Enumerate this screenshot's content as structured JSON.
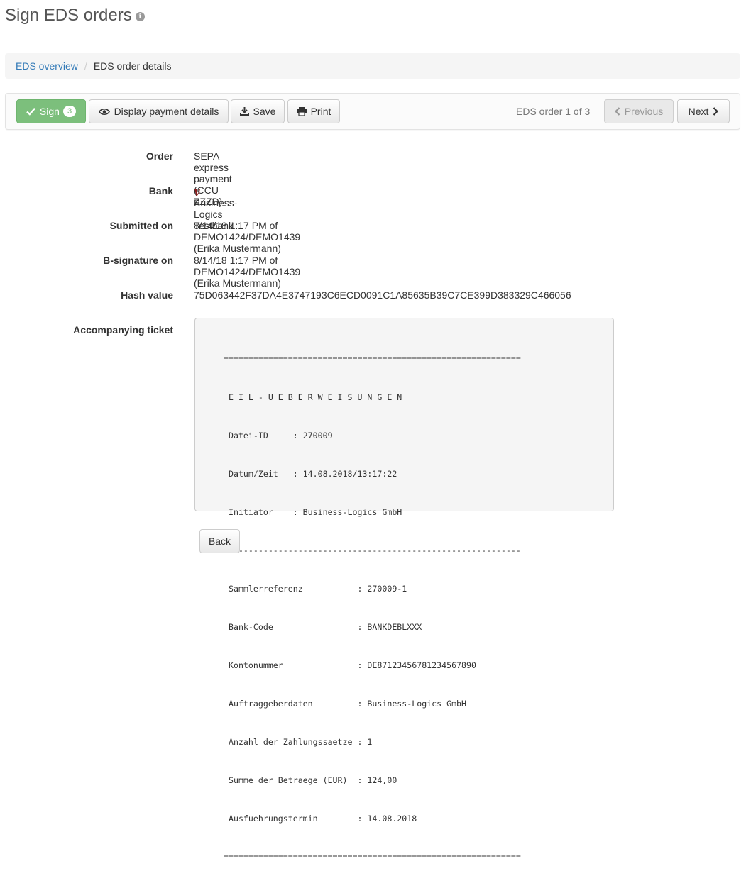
{
  "header": {
    "title": "Sign EDS orders",
    "info_icon": "info-icon"
  },
  "breadcrumb": {
    "items": [
      "EDS overview",
      "EDS order details"
    ]
  },
  "toolbar": {
    "sign_label": "Sign",
    "sign_count": "3",
    "display_label": "Display payment details",
    "save_label": "Save",
    "print_label": "Print",
    "order_counter": "EDS order 1 of 3",
    "previous_label": "Previous",
    "next_label": "Next"
  },
  "details": {
    "order_label": "Order",
    "order_value": "SEPA express payment (CCU ZZZD)",
    "bank_label": "Bank",
    "bank_value": "Business-Logics Testbank",
    "submitted_label": "Submitted on",
    "submitted_value": "8/14/18 1:17 PM of DEMO1424/DEMO1439 (Erika Mustermann)",
    "bsig_label": "B-signature on",
    "bsig_value": "8/14/18 1:17 PM of DEMO1424/DEMO1439 (Erika Mustermann)",
    "hash_label": "Hash value",
    "hash_value": "75D063442F37DA4E3747193C6ECD0091C1A85635B39C7CE399D383329C466056",
    "ticket_label": "Accompanying ticket",
    "ticket_lines": [
      "============================================================",
      " E I L - U E B E R W E I S U N G E N",
      " Datei-ID     : 270009",
      " Datum/Zeit   : 14.08.2018/13:17:22",
      " Initiator    : Business-Logics GmbH",
      "------------------------------------------------------------",
      " Sammlerreferenz           : 270009-1",
      " Bank-Code                 : BANKDEBLXXX",
      " Kontonummer               : DE87123456781234567890",
      " Auftraggeberdaten         : Business-Logics GmbH",
      " Anzahl der Zahlungssaetze : 1",
      " Summe der Betraege (EUR)  : 124,00",
      " Ausfuehrungstermin        : 14.08.2018",
      "============================================================"
    ]
  },
  "footer": {
    "back_label": "Back"
  }
}
